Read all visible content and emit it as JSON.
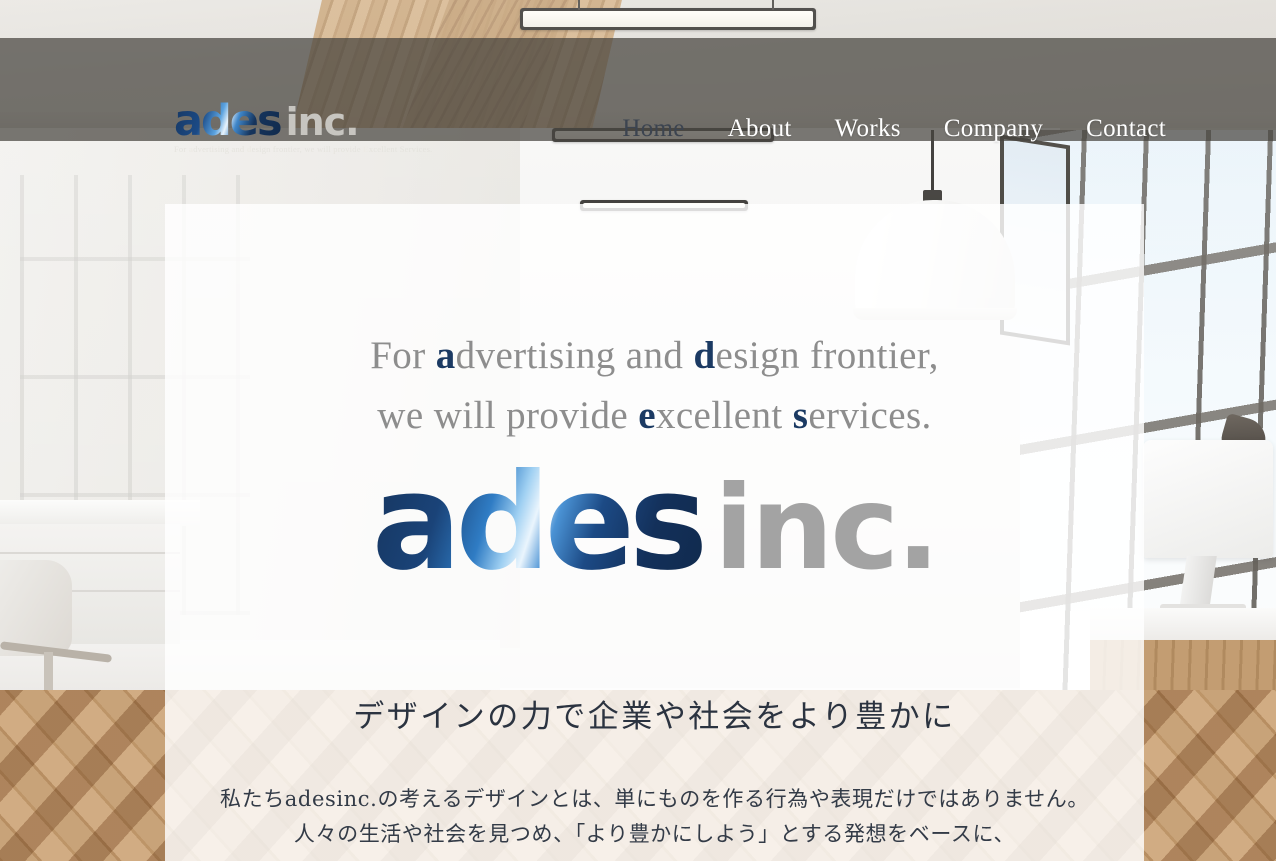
{
  "site": {
    "brand_name_primary": "ades",
    "brand_name_secondary": "inc.",
    "tagline_prefix": "For ",
    "tagline_a": "a",
    "tagline_mid1": "dvertising and ",
    "tagline_d": "d",
    "tagline_mid2": "esign frontier, we will provide ",
    "tagline_e": "E",
    "tagline_suffix": "xcellent Services."
  },
  "header": {
    "nav": [
      {
        "label": "Home",
        "active": true
      },
      {
        "label": "About",
        "active": false
      },
      {
        "label": "Works",
        "active": false
      },
      {
        "label": "Company",
        "active": false
      },
      {
        "label": "Contact",
        "active": false
      }
    ],
    "bar_color": "#46443f"
  },
  "hero": {
    "line1_part1": "For ",
    "line1_accent1": "a",
    "line1_part2": "dvertising and ",
    "line1_accent2": "d",
    "line1_part3": "esign frontier,",
    "line2_part1": "we will provide ",
    "line2_accent1": "e",
    "line2_part2": "xcellent ",
    "line2_accent2": "s",
    "line2_part3": "ervices.",
    "accent_color": "#1b3a63",
    "text_color": "#8d8d8d",
    "logo_primary": "ades",
    "logo_secondary": "inc."
  },
  "main": {
    "heading_jp": "デザインの力で企業や社会をより豊かに",
    "body_jp": [
      "私たちadesinc.の考えるデザインとは、単にものを作る行為や表現だけではありません。",
      "人々の生活や社会を見つめ、「より豊かにしよう」とする発想をベースに、"
    ]
  }
}
